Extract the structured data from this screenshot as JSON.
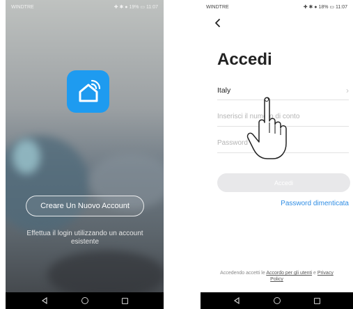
{
  "left_screen": {
    "status": {
      "carrier": "WINDTRE",
      "right": "✚ ✱ ● 19% ▭ 11:07"
    },
    "logo_icon": "smart-home-icon",
    "create_button_label": "Creare Un Nuovo Account",
    "login_hint": "Effettua il login utilizzando un account esistente",
    "nav": {
      "back": "back-icon",
      "home": "home-icon",
      "recents": "recents-icon"
    }
  },
  "right_screen": {
    "status": {
      "carrier": "WINDTRE",
      "right": "✚ ✱ ● 18% ▭ 11:07"
    },
    "title": "Accedi",
    "country_value": "Italy",
    "account_placeholder": "Inserisci il numero di conto",
    "password_placeholder": "Password",
    "login_button_label": "Accedi",
    "forgot_label": "Password dimenticata",
    "terms_prefix": "Accedendo accetti le ",
    "terms_link1": "Accordo per gli utenti",
    "terms_mid": " e ",
    "terms_link2": "Privacy",
    "terms_link2_cont": "Policy"
  },
  "colors": {
    "accent": "#1e9bf0",
    "link": "#2f8de4",
    "disabled_button": "#e8e8ea"
  }
}
